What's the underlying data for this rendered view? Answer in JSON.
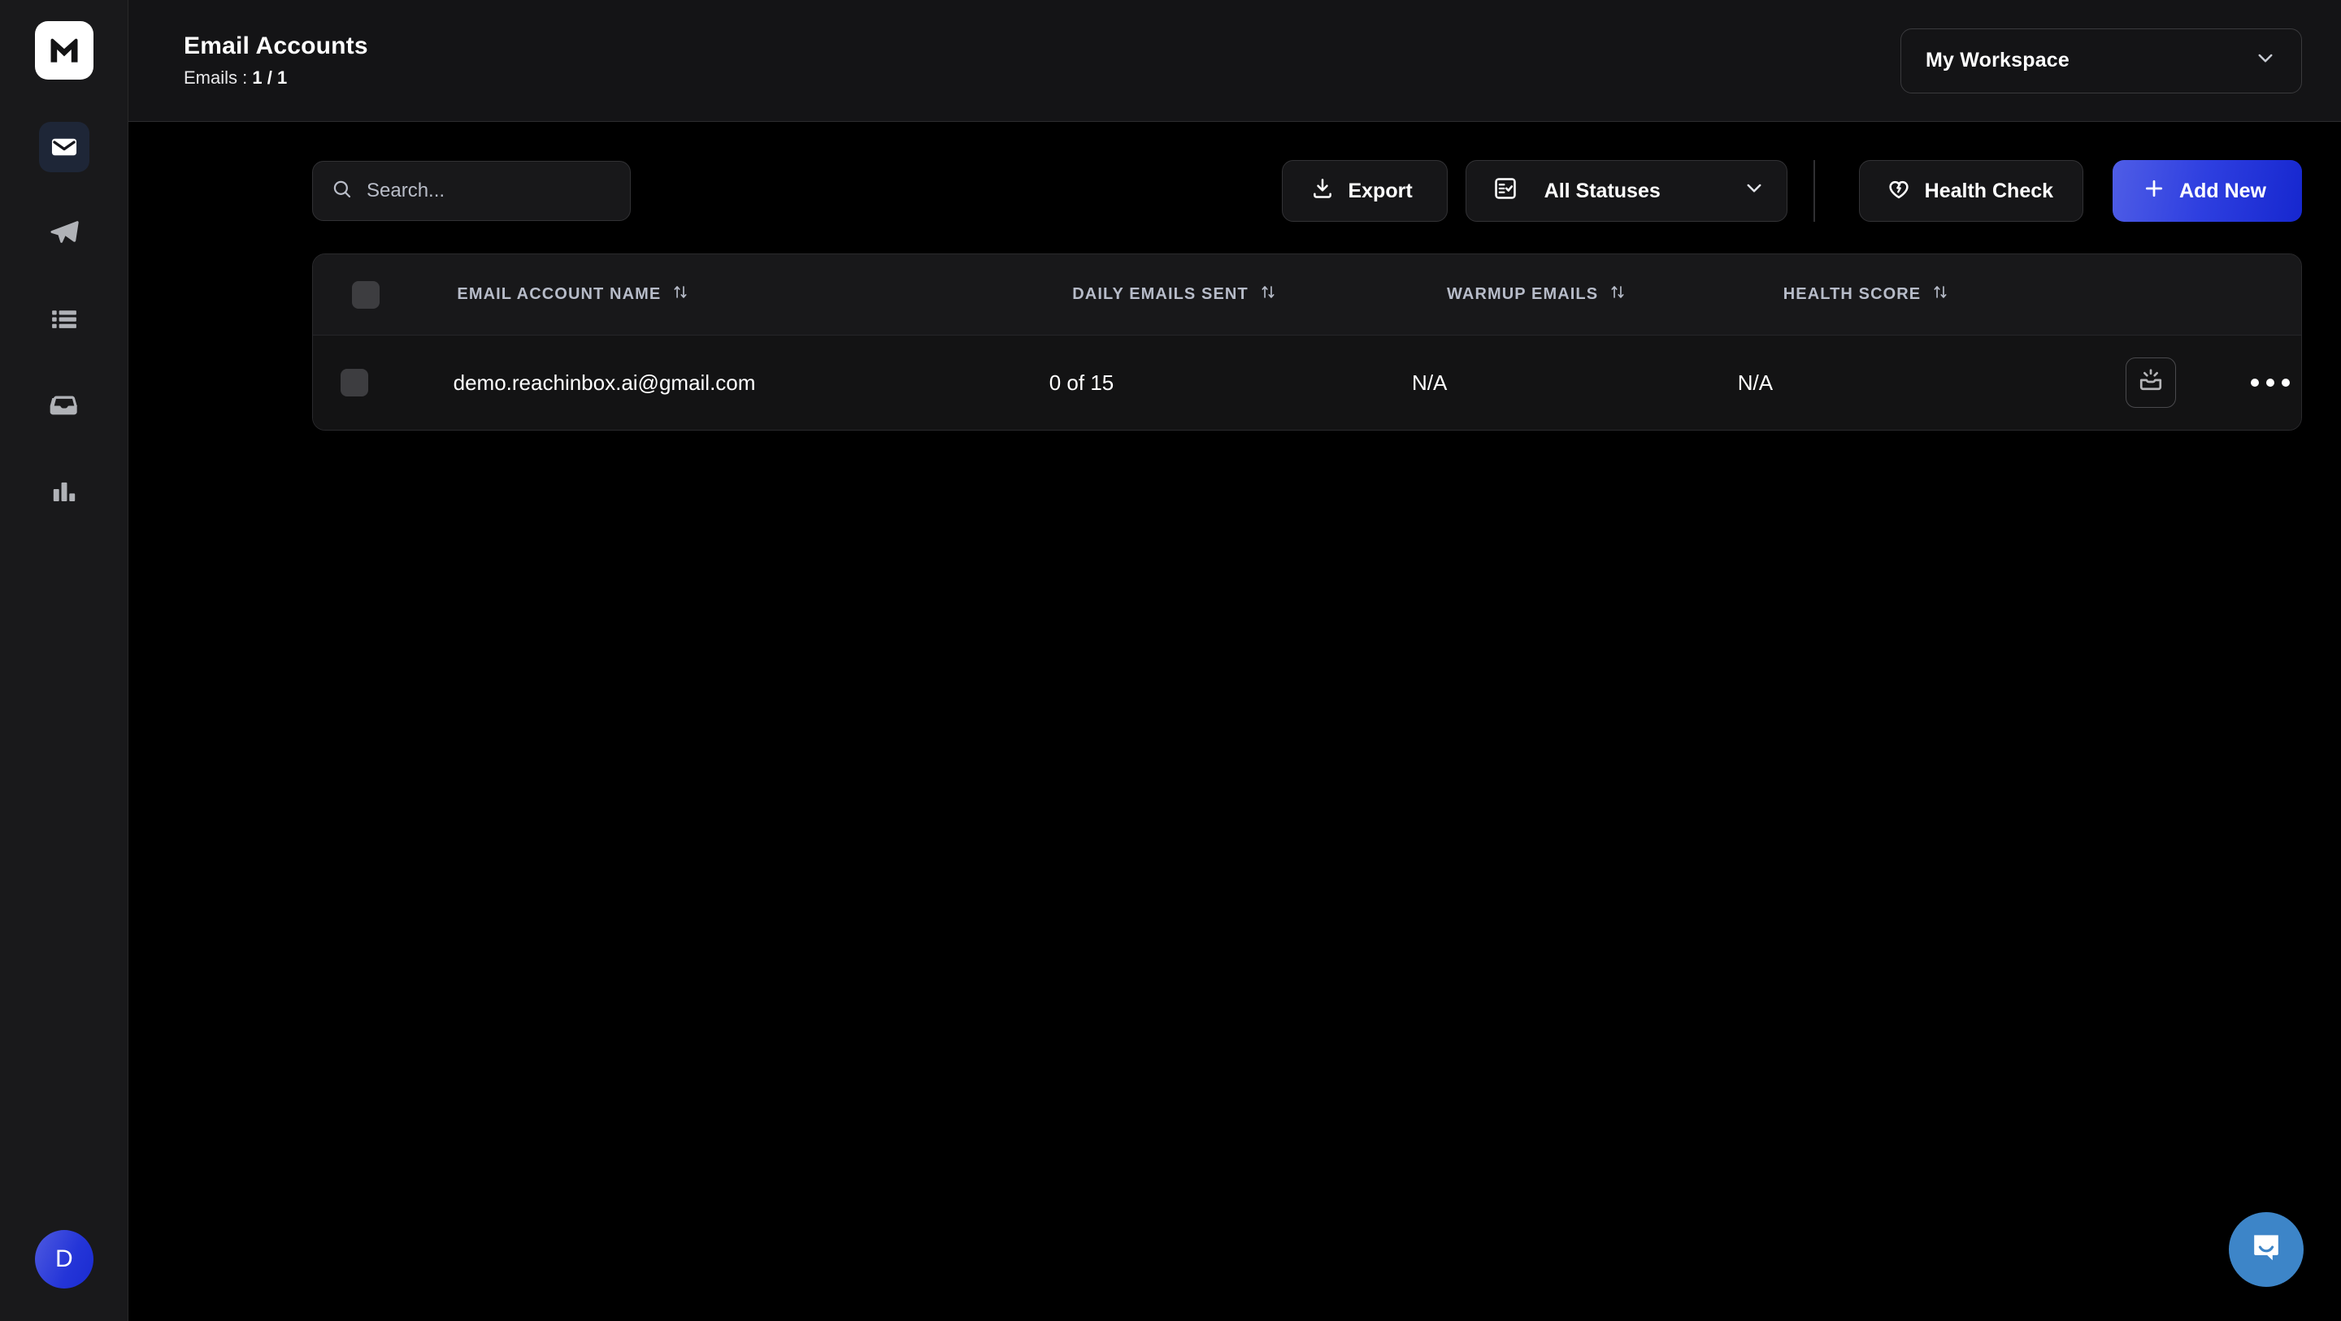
{
  "sidebar": {
    "logo_alt": "reachinbox-logo",
    "items": [
      {
        "name": "mail",
        "label": "Email Accounts",
        "active": true
      },
      {
        "name": "send",
        "label": "Campaigns",
        "active": false
      },
      {
        "name": "list",
        "label": "Lists",
        "active": false
      },
      {
        "name": "inbox",
        "label": "Unibox",
        "active": false
      },
      {
        "name": "analytics",
        "label": "Analytics",
        "active": false
      }
    ],
    "avatar_initial": "D"
  },
  "header": {
    "title": "Email Accounts",
    "subtitle_label": "Emails :",
    "subtitle_value": "1 / 1",
    "workspace": "My Workspace"
  },
  "toolbar": {
    "search_placeholder": "Search...",
    "search_value": "",
    "export_label": "Export",
    "status_filter_label": "All Statuses",
    "health_check_label": "Health Check",
    "add_new_label": "Add New"
  },
  "table": {
    "columns": [
      {
        "key": "name",
        "label": "EMAIL ACCOUNT NAME",
        "sortable": true
      },
      {
        "key": "daily",
        "label": "DAILY EMAILS SENT",
        "sortable": true
      },
      {
        "key": "warmup",
        "label": "WARMUP EMAILS",
        "sortable": true
      },
      {
        "key": "health",
        "label": "HEALTH SCORE",
        "sortable": true
      }
    ],
    "rows": [
      {
        "name": "demo.reachinbox.ai@gmail.com",
        "daily": "0 of 15",
        "warmup": "N/A",
        "health": "N/A",
        "action_icon": "inbox-rays-icon",
        "more_icon": "ellipsis-icon"
      }
    ]
  },
  "chat": {
    "icon": "chat-bubble-icon"
  },
  "colors": {
    "accent_primary": "#2e3fe0",
    "accent_chat": "#3d85c8",
    "sidebar_bg": "#19191b",
    "topbar_bg": "#141416",
    "content_bg": "#000000",
    "table_head_bg": "#18181a",
    "table_row_bg": "#131314",
    "active_nav_bg": "#1e2637",
    "muted_text": "#b7bcc9"
  }
}
